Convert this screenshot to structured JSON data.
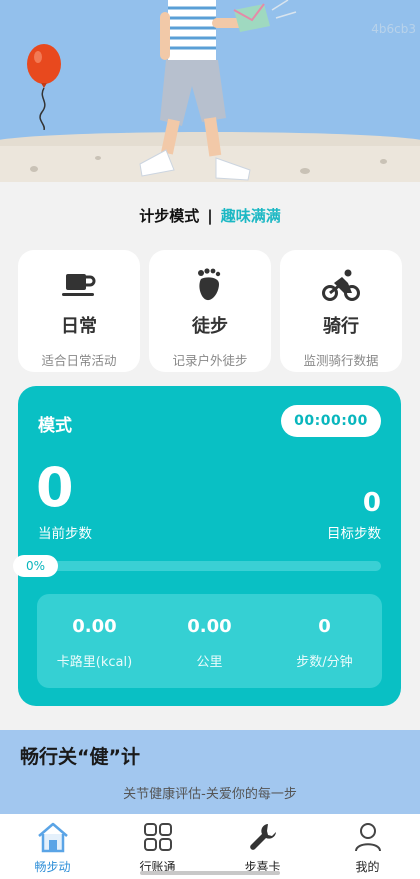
{
  "hero": {
    "watermark": "4b6cb3"
  },
  "mode_header": {
    "label": "计步模式",
    "separator": "|",
    "fun_label": "趣味满满"
  },
  "modes": [
    {
      "icon": "coffee-cup-icon",
      "title": "日常",
      "subtitle": "适合日常活动"
    },
    {
      "icon": "footprint-icon",
      "title": "徒步",
      "subtitle": "记录户外徒步"
    },
    {
      "icon": "cyclist-icon",
      "title": "骑行",
      "subtitle": "监测骑行数据"
    }
  ],
  "stats": {
    "mode_label": "模式",
    "timer": "00:00:00",
    "current_steps": "0",
    "current_steps_label": "当前步数",
    "goal_steps": "0",
    "goal_steps_label": "目标步数",
    "progress_label": "0%",
    "progress_fraction": 0,
    "calories_value": "0.00",
    "calories_label": "卡路里(kcal)",
    "distance_value": "0.00",
    "distance_label": "公里",
    "cadence_value": "0",
    "cadence_label": "步数/分钟"
  },
  "health": {
    "title": "畅行关“健”计",
    "subtitle": "关节健康评估-关爱你的每一步"
  },
  "tabs": [
    {
      "icon": "home-icon",
      "label": "畅步动",
      "active": true
    },
    {
      "icon": "grid-icon",
      "label": "行账通",
      "active": false
    },
    {
      "icon": "wrench-icon",
      "label": "步喜卡",
      "active": false
    },
    {
      "icon": "user-icon",
      "label": "我的",
      "active": false
    }
  ],
  "colors": {
    "accent": "#09c0c4",
    "active_tab": "#2f8fd8",
    "hero_sky": "#93c0ec",
    "health_banner": "#a2c7ef"
  }
}
